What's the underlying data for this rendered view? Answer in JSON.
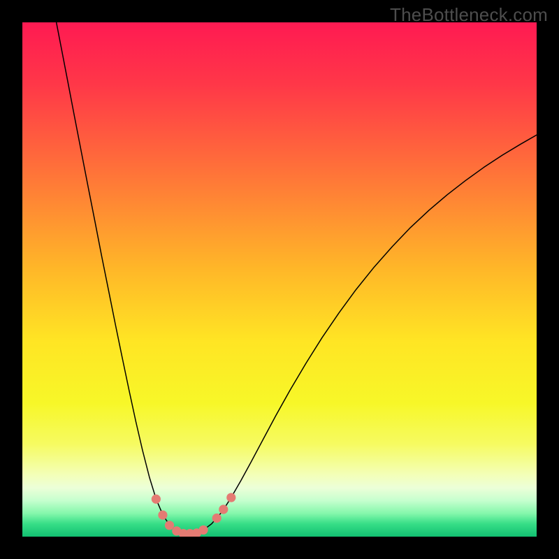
{
  "watermark": "TheBottleneck.com",
  "chart_data": {
    "type": "line",
    "title": "",
    "xlabel": "",
    "ylabel": "",
    "xlim": [
      0,
      100
    ],
    "ylim": [
      0,
      100
    ],
    "grid": false,
    "legend": false,
    "background": {
      "type": "vertical-gradient",
      "stops": [
        {
          "offset": 0.0,
          "color": "#ff1a52"
        },
        {
          "offset": 0.12,
          "color": "#ff3748"
        },
        {
          "offset": 0.3,
          "color": "#ff7638"
        },
        {
          "offset": 0.48,
          "color": "#ffb728"
        },
        {
          "offset": 0.62,
          "color": "#ffe524"
        },
        {
          "offset": 0.74,
          "color": "#f7f728"
        },
        {
          "offset": 0.82,
          "color": "#f6fb61"
        },
        {
          "offset": 0.88,
          "color": "#f3ffb8"
        },
        {
          "offset": 0.905,
          "color": "#ecffd8"
        },
        {
          "offset": 0.93,
          "color": "#c5ffce"
        },
        {
          "offset": 0.955,
          "color": "#84f7ab"
        },
        {
          "offset": 0.975,
          "color": "#37de87"
        },
        {
          "offset": 1.0,
          "color": "#12c071"
        }
      ]
    },
    "series": [
      {
        "name": "bottleneck-curve",
        "color": "#000000",
        "width": 1.5,
        "x": [
          6.61,
          7.5,
          8.83,
          10.15,
          11.47,
          12.79,
          14.11,
          15.43,
          16.76,
          18.08,
          19.4,
          20.72,
          22.04,
          23.36,
          24.69,
          26.01,
          27.33,
          28.65,
          29.97,
          31.29,
          32.07,
          33.05,
          34.06,
          35.19,
          36.8,
          38.8,
          40.6,
          42.5,
          44.41,
          46.7,
          49.27,
          52.06,
          55.14,
          58.28,
          61.56,
          64.85,
          68.39,
          71.93,
          75.46,
          79.1,
          82.64,
          86.12,
          89.72,
          93.37,
          96.85,
          99.99
        ],
        "y": [
          100.0,
          95.4,
          88.5,
          81.6,
          74.8,
          68.0,
          61.3,
          54.5,
          47.9,
          41.3,
          34.9,
          28.6,
          22.5,
          16.8,
          11.6,
          7.3,
          4.2,
          2.2,
          1.1,
          0.6,
          0.51,
          0.56,
          0.77,
          1.28,
          2.5,
          4.8,
          7.6,
          10.9,
          14.4,
          18.7,
          23.5,
          28.5,
          33.7,
          38.7,
          43.5,
          48.0,
          52.4,
          56.4,
          60.1,
          63.5,
          66.5,
          69.2,
          71.8,
          74.2,
          76.3,
          78.1
        ]
      }
    ],
    "markers": {
      "name": "highlight-dots",
      "color": "#e47b73",
      "radius": 6.6,
      "points": [
        {
          "x": 26.0,
          "y": 7.3
        },
        {
          "x": 27.3,
          "y": 4.2
        },
        {
          "x": 28.6,
          "y": 2.2
        },
        {
          "x": 30.0,
          "y": 1.1
        },
        {
          "x": 31.3,
          "y": 0.6
        },
        {
          "x": 32.6,
          "y": 0.6
        },
        {
          "x": 33.9,
          "y": 0.7
        },
        {
          "x": 35.2,
          "y": 1.3
        },
        {
          "x": 37.8,
          "y": 3.6
        },
        {
          "x": 39.1,
          "y": 5.3
        },
        {
          "x": 40.6,
          "y": 7.6
        }
      ]
    }
  }
}
